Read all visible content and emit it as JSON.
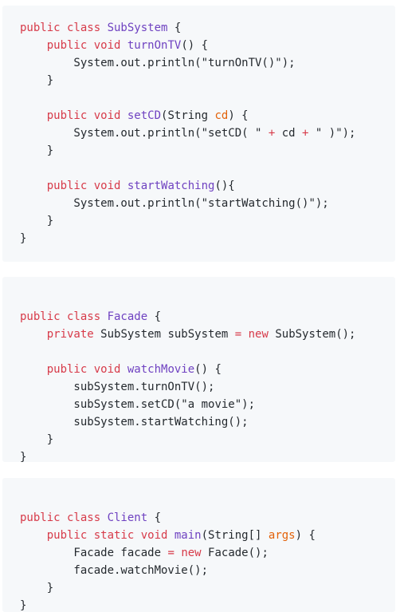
{
  "colors": {
    "block_background": "#f6f8fa",
    "keyword": "#d73a49",
    "name": "#6f42c1",
    "param": "#e36209",
    "plain": "#24292e"
  },
  "blocks": [
    {
      "id": "subsystem-class",
      "lines": [
        [
          {
            "t": "keyword",
            "v": "public class "
          },
          {
            "t": "name",
            "v": "SubSystem"
          },
          {
            "t": "plain",
            "v": " {"
          }
        ],
        [
          {
            "t": "plain",
            "v": "    "
          },
          {
            "t": "keyword",
            "v": "public void "
          },
          {
            "t": "name",
            "v": "turnOnTV"
          },
          {
            "t": "plain",
            "v": "() {"
          }
        ],
        [
          {
            "t": "plain",
            "v": "        System.out.println("
          },
          {
            "t": "string",
            "v": "\"turnOnTV()\""
          },
          {
            "t": "plain",
            "v": ");"
          }
        ],
        [
          {
            "t": "plain",
            "v": "    }"
          }
        ],
        [
          {
            "t": "plain",
            "v": ""
          }
        ],
        [
          {
            "t": "plain",
            "v": "    "
          },
          {
            "t": "keyword",
            "v": "public void "
          },
          {
            "t": "name",
            "v": "setCD"
          },
          {
            "t": "plain",
            "v": "(String "
          },
          {
            "t": "param",
            "v": "cd"
          },
          {
            "t": "plain",
            "v": ") {"
          }
        ],
        [
          {
            "t": "plain",
            "v": "        System.out.println("
          },
          {
            "t": "string",
            "v": "\"setCD( \""
          },
          {
            "t": "plain",
            "v": " "
          },
          {
            "t": "op",
            "v": "+"
          },
          {
            "t": "plain",
            "v": " cd "
          },
          {
            "t": "op",
            "v": "+"
          },
          {
            "t": "plain",
            "v": " "
          },
          {
            "t": "string",
            "v": "\" )\""
          },
          {
            "t": "plain",
            "v": ");"
          }
        ],
        [
          {
            "t": "plain",
            "v": "    }"
          }
        ],
        [
          {
            "t": "plain",
            "v": ""
          }
        ],
        [
          {
            "t": "plain",
            "v": "    "
          },
          {
            "t": "keyword",
            "v": "public void "
          },
          {
            "t": "name",
            "v": "startWatching"
          },
          {
            "t": "plain",
            "v": "(){"
          }
        ],
        [
          {
            "t": "plain",
            "v": "        System.out.println("
          },
          {
            "t": "string",
            "v": "\"startWatching()\""
          },
          {
            "t": "plain",
            "v": ");"
          }
        ],
        [
          {
            "t": "plain",
            "v": "    }"
          }
        ],
        [
          {
            "t": "plain",
            "v": "}"
          }
        ]
      ]
    },
    {
      "id": "facade-class",
      "lines": [
        [
          {
            "t": "plain",
            "v": ""
          }
        ],
        [
          {
            "t": "keyword",
            "v": "public class "
          },
          {
            "t": "name",
            "v": "Facade"
          },
          {
            "t": "plain",
            "v": " {"
          }
        ],
        [
          {
            "t": "plain",
            "v": "    "
          },
          {
            "t": "keyword",
            "v": "private "
          },
          {
            "t": "plain",
            "v": "SubSystem subSystem "
          },
          {
            "t": "op",
            "v": "="
          },
          {
            "t": "plain",
            "v": " "
          },
          {
            "t": "keyword",
            "v": "new"
          },
          {
            "t": "plain",
            "v": " SubSystem();"
          }
        ],
        [
          {
            "t": "plain",
            "v": ""
          }
        ],
        [
          {
            "t": "plain",
            "v": "    "
          },
          {
            "t": "keyword",
            "v": "public void "
          },
          {
            "t": "name",
            "v": "watchMovie"
          },
          {
            "t": "plain",
            "v": "() {"
          }
        ],
        [
          {
            "t": "plain",
            "v": "        subSystem.turnOnTV();"
          }
        ],
        [
          {
            "t": "plain",
            "v": "        subSystem.setCD("
          },
          {
            "t": "string",
            "v": "\"a movie\""
          },
          {
            "t": "plain",
            "v": ");"
          }
        ],
        [
          {
            "t": "plain",
            "v": "        subSystem.startWatching();"
          }
        ],
        [
          {
            "t": "plain",
            "v": "    }"
          }
        ],
        [
          {
            "t": "plain",
            "v": "}"
          }
        ]
      ]
    },
    {
      "id": "client-class",
      "lines": [
        [
          {
            "t": "plain",
            "v": ""
          }
        ],
        [
          {
            "t": "keyword",
            "v": "public class "
          },
          {
            "t": "name",
            "v": "Client"
          },
          {
            "t": "plain",
            "v": " {"
          }
        ],
        [
          {
            "t": "plain",
            "v": "    "
          },
          {
            "t": "keyword",
            "v": "public static void "
          },
          {
            "t": "name",
            "v": "main"
          },
          {
            "t": "plain",
            "v": "(String[] "
          },
          {
            "t": "param",
            "v": "args"
          },
          {
            "t": "plain",
            "v": ") {"
          }
        ],
        [
          {
            "t": "plain",
            "v": "        Facade facade "
          },
          {
            "t": "op",
            "v": "="
          },
          {
            "t": "plain",
            "v": " "
          },
          {
            "t": "keyword",
            "v": "new"
          },
          {
            "t": "plain",
            "v": " Facade();"
          }
        ],
        [
          {
            "t": "plain",
            "v": "        facade.watchMovie();"
          }
        ],
        [
          {
            "t": "plain",
            "v": "    }"
          }
        ],
        [
          {
            "t": "plain",
            "v": "}"
          }
        ]
      ]
    }
  ]
}
